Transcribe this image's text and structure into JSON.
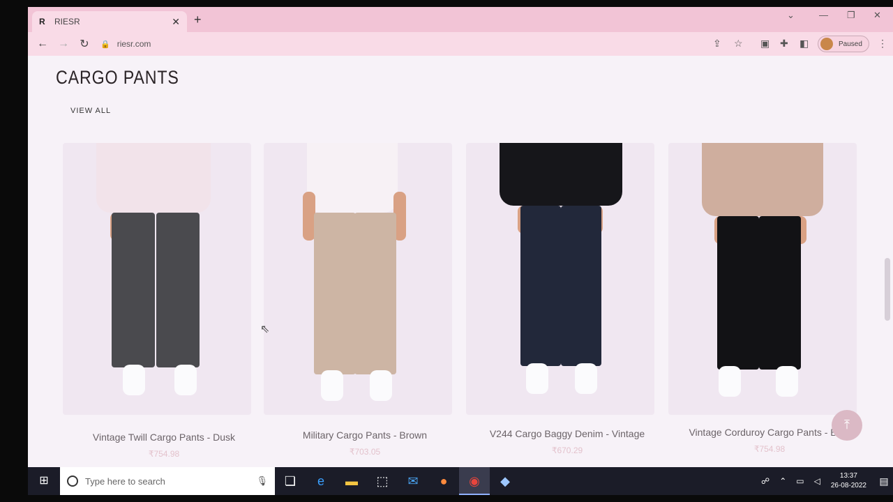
{
  "browser": {
    "tab_title": "RIESR",
    "tab_favicon": "R",
    "url": "riesr.com",
    "profile_status": "Paused"
  },
  "page": {
    "heading": "CARGO PANTS",
    "view_all": "VIEW ALL",
    "products": [
      {
        "name": "Vintage Twill Cargo Pants - Dusk",
        "price": "₹754.98"
      },
      {
        "name": "Military Cargo Pants - Brown",
        "price": "₹703.05"
      },
      {
        "name": "V244 Cargo Baggy Denim - Vintage",
        "price": "₹670.29"
      },
      {
        "name": "Vintage Corduroy Cargo Pants - Bla",
        "price": "₹754.98"
      }
    ]
  },
  "taskbar": {
    "search_placeholder": "Type here to search",
    "time": "13:37",
    "date": "26-08-2022"
  },
  "colors": {
    "tabstrip": "#f2c4d6",
    "toolbar": "#f9dbe7",
    "page_bg": "#f7f2f8",
    "taskbar": "#1b1c28"
  }
}
